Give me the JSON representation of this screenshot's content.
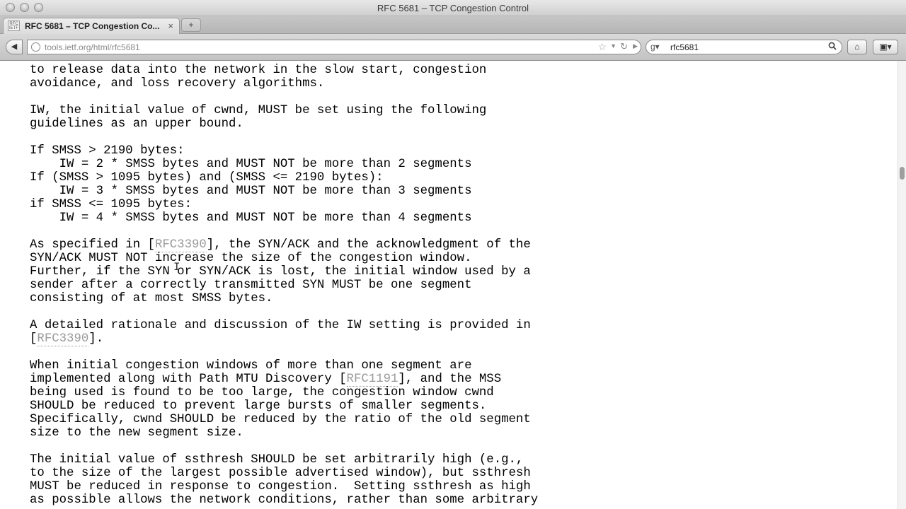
{
  "window": {
    "title": "RFC 5681 – TCP Congestion Control"
  },
  "tabs": [
    {
      "favicon_text": "RFC IETF",
      "label": "RFC 5681 – TCP Congestion Co..."
    }
  ],
  "newtab_label": "+",
  "watermark": "",
  "toolbar": {
    "url": "tools.ietf.org/html/rfc5681",
    "search_engine_icon": "google-g",
    "search_query": "rfc5681"
  },
  "content": {
    "line_first": "to release data into the network in the slow start, congestion",
    "line_2": "avoidance, and loss recovery algorithms.",
    "line_4": "IW, the initial value of cwnd, MUST be set using the following",
    "line_5": "guidelines as an upper bound.",
    "line_7": "If SMSS > 2190 bytes:",
    "line_8": "    IW = 2 * SMSS bytes and MUST NOT be more than 2 segments",
    "line_9": "If (SMSS > 1095 bytes) and (SMSS <= 2190 bytes):",
    "line_10": "    IW = 3 * SMSS bytes and MUST NOT be more than 3 segments",
    "line_11": "if SMSS <= 1095 bytes:",
    "line_12": "    IW = 4 * SMSS bytes and MUST NOT be more than 4 segments",
    "p2_a": "As specified in [",
    "p2_ref": "RFC3390",
    "p2_b": "], the SYN/ACK and the acknowledgment of the",
    "line_15": "SYN/ACK MUST NOT increase the size of the congestion window.",
    "line_16": "Further, if the SYN or SYN/ACK is lost, the initial window used by a",
    "line_17": "sender after a correctly transmitted SYN MUST be one segment",
    "line_18": "consisting of at most SMSS bytes.",
    "line_20": "A detailed rationale and discussion of the IW setting is provided in",
    "p3_a": "[",
    "p3_ref": "RFC3390",
    "p3_b": "].",
    "line_23": "When initial congestion windows of more than one segment are",
    "p4_a": "implemented along with Path MTU Discovery [",
    "p4_ref": "RFC1191",
    "p4_b": "], and the MSS",
    "line_25": "being used is found to be too large, the congestion window cwnd",
    "line_26": "SHOULD be reduced to prevent large bursts of smaller segments.",
    "line_27": "Specifically, cwnd SHOULD be reduced by the ratio of the old segment",
    "line_28": "size to the new segment size.",
    "line_30": "The initial value of ssthresh SHOULD be set arbitrarily high (e.g.,",
    "line_31": "to the size of the largest possible advertised window), but ssthresh",
    "line_32": "MUST be reduced in response to congestion.  Setting ssthresh as high",
    "line_33": "as possible allows the network conditions, rather than some arbitrary"
  },
  "icons": {
    "back": "back-arrow-icon",
    "home": "home-icon",
    "tools": "tools-menu-icon",
    "bookmark": "star-icon",
    "reload": "reload-icon",
    "search": "search-icon"
  }
}
